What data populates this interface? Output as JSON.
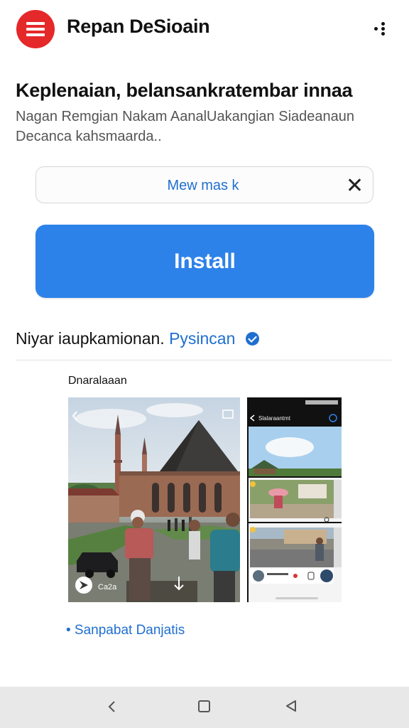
{
  "header": {
    "app_title": "Repan DeSioain",
    "logo_icon": "menu-lines-icon",
    "more_icon": "more-dots-icon"
  },
  "app": {
    "headline": "Keplenaian, belansankratembar innaa",
    "description": "Nagan Remgian Nakam AanalUakangian Siadeanaun Decanca kahsmaarda.."
  },
  "option": {
    "label": "Mew mas k",
    "close_icon": "close-icon"
  },
  "install": {
    "label": "Install"
  },
  "developer": {
    "prefix": "Niyar iaupkamionan.",
    "name": "Pysincan",
    "badge_icon": "verified-check-icon"
  },
  "screenshots": {
    "section_label": "Dnaralaaan",
    "main_caption": "Ca2a",
    "side_title": "Slalaraantmt"
  },
  "link": {
    "label": "• Sanpabat Danjatis"
  },
  "colors": {
    "logo_red": "#e5282a",
    "accent_blue": "#2d82ea",
    "link_blue": "#1f6fd0"
  }
}
